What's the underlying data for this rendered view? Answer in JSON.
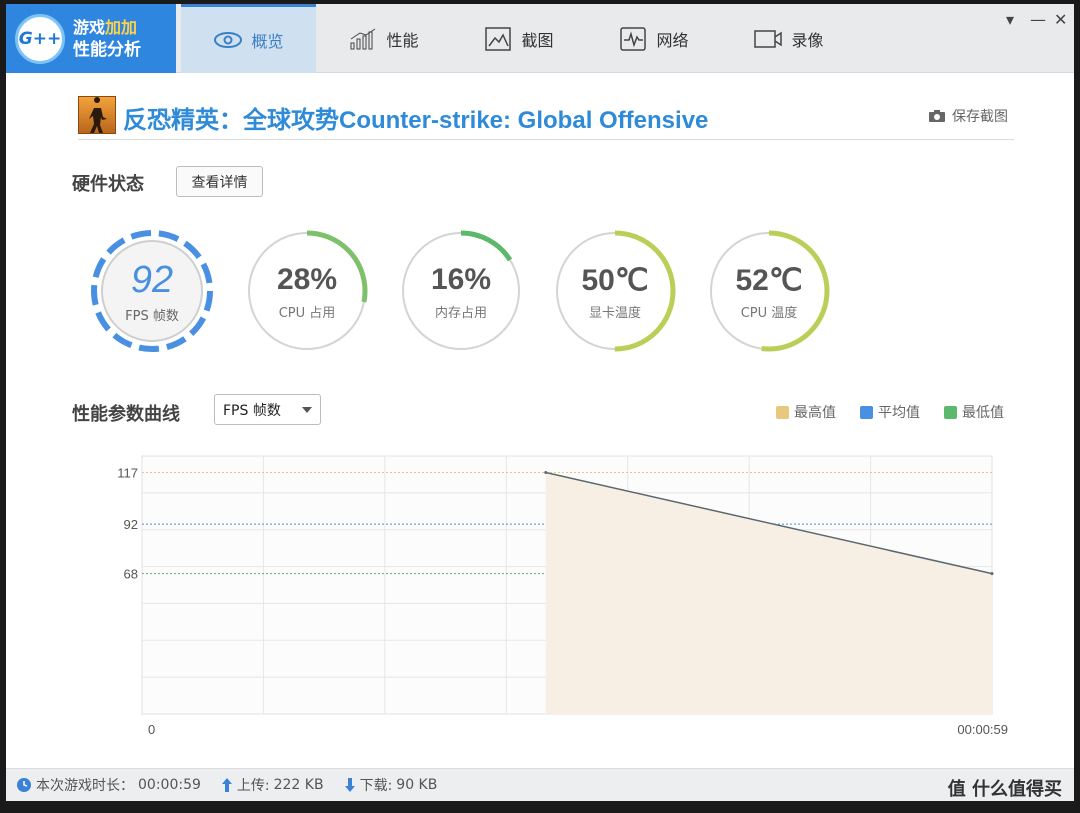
{
  "app": {
    "logo_badge": "G++",
    "logo_line1_a": "游戏",
    "logo_line1_b": "加加",
    "logo_line2": "性能分析"
  },
  "tabs": [
    {
      "label": "概览",
      "icon": "eye-icon",
      "active": true
    },
    {
      "label": "性能",
      "icon": "bar-chart-icon",
      "active": false
    },
    {
      "label": "截图",
      "icon": "image-icon",
      "active": false
    },
    {
      "label": "网络",
      "icon": "pulse-icon",
      "active": false
    },
    {
      "label": "录像",
      "icon": "video-camera-icon",
      "active": false
    }
  ],
  "game": {
    "title": "反恐精英：全球攻势Counter-strike: Global Offensive",
    "save_screenshot": "保存截图"
  },
  "hardware": {
    "title": "硬件状态",
    "details_button": "查看详情",
    "gauges": [
      {
        "value": "92",
        "label": "FPS 帧数",
        "fill": 1.0,
        "color": "#4a90e2"
      },
      {
        "value": "28%",
        "label": "CPU 占用",
        "fill": 0.28,
        "color": "#7fc16b"
      },
      {
        "value": "16%",
        "label": "内存占用",
        "fill": 0.16,
        "color": "#5cb86a"
      },
      {
        "value": "50℃",
        "label": "显卡温度",
        "fill": 0.5,
        "color": "#b9cf58"
      },
      {
        "value": "52℃",
        "label": "CPU 温度",
        "fill": 0.52,
        "color": "#b9cf58"
      }
    ]
  },
  "curve": {
    "title": "性能参数曲线",
    "select_value": "FPS 帧数",
    "legend": [
      {
        "label": "最高值",
        "color": "#e8c87e"
      },
      {
        "label": "平均值",
        "color": "#4a90e2"
      },
      {
        "label": "最低值",
        "color": "#5cb86a"
      }
    ]
  },
  "chart_data": {
    "type": "area",
    "x": [
      "00:00:00",
      "00:00:59"
    ],
    "series": [
      {
        "values": [
          117,
          68
        ]
      }
    ],
    "reference_lines": [
      {
        "label": "117",
        "value": 117,
        "color": "#e8c87e"
      },
      {
        "label": "92",
        "value": 92,
        "color": "#4a90e2"
      },
      {
        "label": "68",
        "value": 68,
        "color": "#5cb86a"
      }
    ],
    "xlim_labels": [
      "0",
      "00:00:59"
    ],
    "ylim": [
      0,
      125
    ],
    "grid": true
  },
  "status": {
    "duration_label": "本次游戏时长：",
    "duration": "00:00:59",
    "upload_label": "上传:",
    "upload": "222 KB",
    "download_label": "下载:",
    "download": "90 KB",
    "watermark": "值 什么值得买"
  }
}
